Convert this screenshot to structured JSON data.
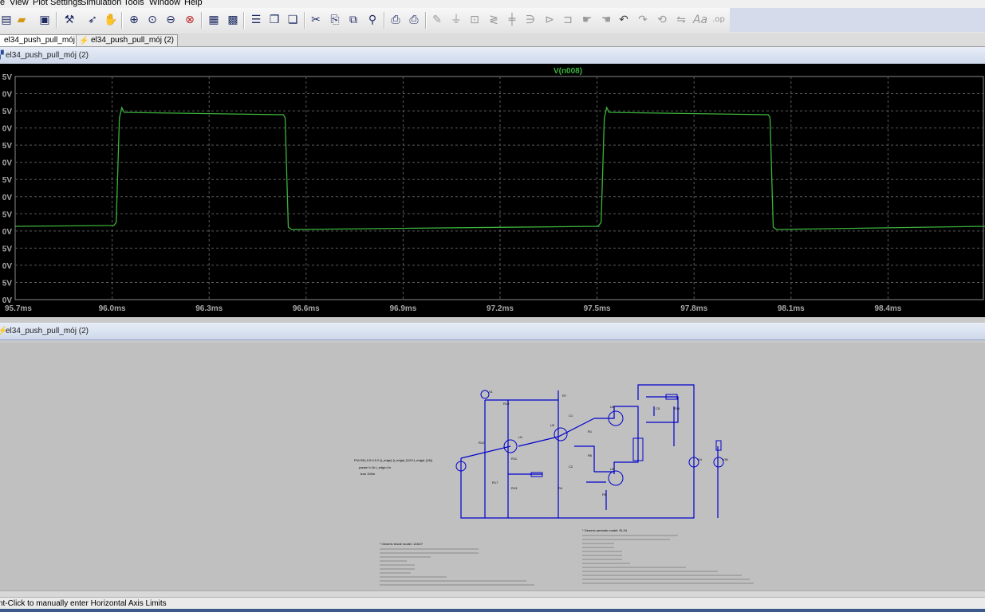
{
  "menu": {
    "items": [
      "e",
      "View",
      "Plot Settings",
      "Simulation",
      "Tools",
      "Window",
      "Help"
    ]
  },
  "toolbar": {
    "icons": [
      "folder-new-icon",
      "folder-open-icon",
      "save-icon",
      "control-panel-icon",
      "run-icon",
      "halt-icon",
      "zoom-in-icon",
      "zoom-fit-icon",
      "zoom-out-icon",
      "zoom-cancel-icon",
      "autorange-icon",
      "manual-limits-icon",
      "tile-horizontal-icon",
      "cascade-icon",
      "tile-vertical-icon",
      "cut-icon",
      "copy-icon",
      "find-icon",
      "print-preview-icon",
      "print-icon",
      "wire-icon",
      "ground-icon",
      "label-net-icon",
      "resistor-icon",
      "capacitor-icon",
      "inductor-icon",
      "diode-icon",
      "component-icon",
      "move-icon",
      "drag-icon",
      "undo-icon",
      "redo-icon",
      "rotate-icon",
      "mirror-icon",
      "text-icon",
      "spice-directive-icon"
    ]
  },
  "tabs": [
    {
      "label": "el34_push_pull_mój (2)",
      "active": true
    },
    {
      "label": "el34_push_pull_mój (2)",
      "active": false
    }
  ],
  "plot_pane": {
    "title": "el34_push_pull_mój (2)"
  },
  "schematic_pane": {
    "title": "el34_push_pull_mój (2)"
  },
  "status": {
    "text": "nt-Click to manually enter Horizontal Axis Limits"
  },
  "colors": {
    "trace": "#3cb33c",
    "grid": "#5a5a5a",
    "axis_text": "#a8a8a8",
    "plot_bg": "#000000",
    "wire": "#0000cc"
  },
  "chart_data": {
    "type": "line",
    "title": "",
    "series": [
      {
        "name": "V(n008)",
        "color": "#3cb33c"
      }
    ],
    "xlabel": "",
    "ylabel": "",
    "x_ticks": [
      "95.7ms",
      "96.0ms",
      "96.3ms",
      "96.6ms",
      "96.9ms",
      "97.2ms",
      "97.5ms",
      "97.8ms",
      "98.1ms",
      "98.4ms"
    ],
    "y_ticks": [
      "5V",
      "0V",
      "5V",
      "0V",
      "5V",
      "0V",
      "5V",
      "0V",
      "5V",
      "0V",
      "5V",
      "0V",
      "5V",
      "0V"
    ],
    "xlim": [
      95.7,
      98.7
    ],
    "grid": true,
    "waveform": {
      "period_ms": 1.5,
      "high_start_ms": 96.02,
      "high_end_ms": 96.54,
      "low_level": -0.45,
      "high_level": 0.92
    }
  },
  "schematic_text": {
    "source_params": "PULSE(-0.5 0.5 0 {t_edge} {t_edge} {1/2/f-t_edge} {1/f})",
    "param_line": ".param f=1k t_edge=1n",
    "tran_line": ".tran 100m",
    "triode_model": "* Generic triode model: 12AX7",
    "pentode_model": "* Generic pentode model: EL34"
  }
}
